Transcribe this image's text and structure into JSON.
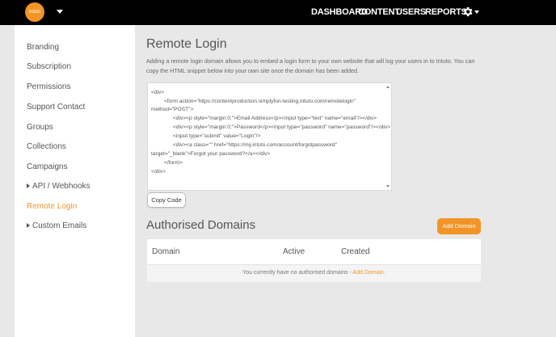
{
  "header": {
    "logo_text": "intuto",
    "nav": [
      "DASHBOARD",
      "CONTENT",
      "USERS",
      "REPORTS"
    ]
  },
  "sidebar": {
    "items": [
      {
        "label": "Branding"
      },
      {
        "label": "Subscription"
      },
      {
        "label": "Permissions"
      },
      {
        "label": "Support Contact"
      },
      {
        "label": "Groups"
      },
      {
        "label": "Collections"
      },
      {
        "label": "Campaigns"
      },
      {
        "label": "API / Webhooks"
      },
      {
        "label": "Remote Login"
      },
      {
        "label": "Custom Emails"
      }
    ]
  },
  "main": {
    "title": "Remote Login",
    "description": "Adding a remote login domain allows you to embed a login form to your own website that will log your users in to Intuto. You can copy the HTML snippet below into your own site once the domain has been added.",
    "code_lines": [
      "<div>",
      "<form action=\"https://contentproduction.simplyfun-testing.intuto.com/remotelogin\"",
      "method=\"POST\">",
      "<div><p style=\"margin:0;\">Email Address</p><input type=\"text\" name=\"email\"/></div>",
      "<div><p style=\"margin:0;\">Password</p><input type=\"password\" name=\"password\"/></div>",
      "<input type=\"submit\" value=\"Login\"/>",
      "<div><a class=\"\" href=\"https://my.intuto.com/account/forgotpassword\"",
      "target=\"_blank\">Forgot your password?</a></div>",
      "</form>",
      "</div>"
    ],
    "copy_button": "Copy Code",
    "domains_title": "Authorised Domains",
    "add_domain_button": "Add Domain",
    "table": {
      "columns": [
        "Domain",
        "Active",
        "Created"
      ],
      "empty_text": "You currently have no authorised domains - ",
      "empty_link": "Add Domain."
    }
  },
  "colors": {
    "accent": "#f39426",
    "topbar": "#000000",
    "background": "#e8e8e8"
  }
}
